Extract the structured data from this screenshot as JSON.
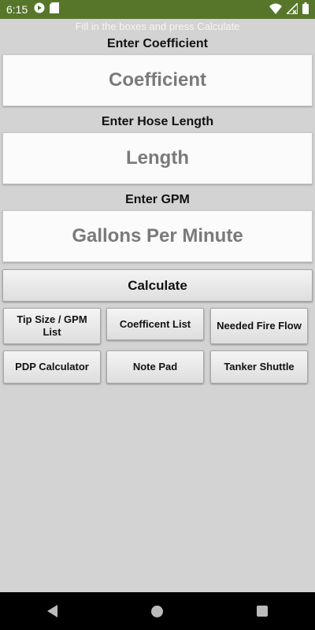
{
  "status_bar": {
    "time": "6:15",
    "icons": [
      "play-protect-icon",
      "sd-card-icon",
      "wifi-icon",
      "no-signal-icon",
      "battery-icon"
    ]
  },
  "instruction": "Fill in the boxes and press Calculate",
  "fields": [
    {
      "label": "Enter Coefficient",
      "placeholder": "Coefficient",
      "value": ""
    },
    {
      "label": "Enter Hose Length",
      "placeholder": "Length",
      "value": ""
    },
    {
      "label": "Enter GPM",
      "placeholder": "Gallons Per Minute",
      "value": ""
    }
  ],
  "buttons": {
    "calculate": "Calculate",
    "tip_size": "Tip Size / GPM List",
    "coefficient_list": "Coefficent List",
    "needed_fire_flow": "Needed Fire Flow",
    "pdp_calculator": "PDP Calculator",
    "note_pad": "Note Pad",
    "tanker_shuttle": "Tanker Shuttle"
  },
  "colors": {
    "status_bar": "#57762a",
    "background": "#d3d3d3",
    "nav_bar": "#000000"
  }
}
